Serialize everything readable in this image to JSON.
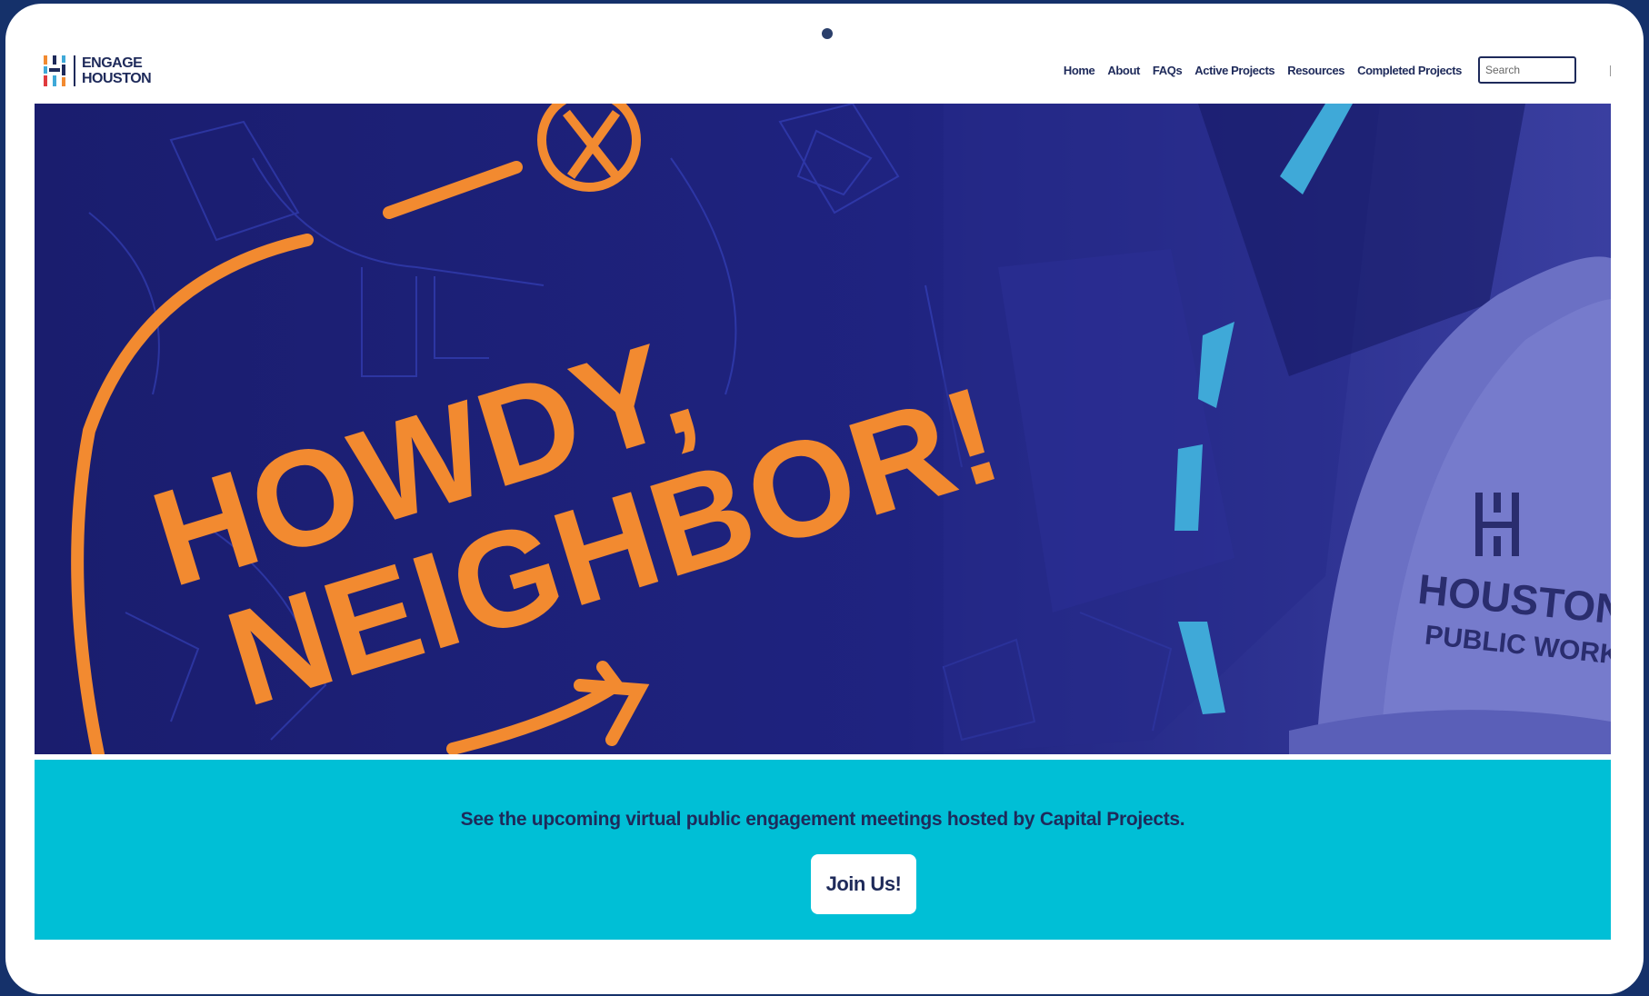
{
  "brand": {
    "line1": "ENGAGE",
    "line2": "HOUSTON"
  },
  "nav": {
    "items": [
      "Home",
      "About",
      "FAQs",
      "Active Projects",
      "Resources",
      "Completed Projects"
    ],
    "search_placeholder": "Search"
  },
  "hero": {
    "headline_line1": "HOWDY,",
    "headline_line2": "NEIGHBOR!",
    "helmet_line1": "HOUSTON",
    "helmet_line2": "PUBLIC WORKS"
  },
  "banner": {
    "text": "See the upcoming virtual public engagement meetings hosted by Capital Projects.",
    "button_label": "Join Us!"
  },
  "colors": {
    "navy": "#1e2a5a",
    "hero_bg": "#1a1d6e",
    "orange": "#f28a30",
    "cyan": "#00bfd6",
    "light_blue": "#3fa9d8"
  }
}
